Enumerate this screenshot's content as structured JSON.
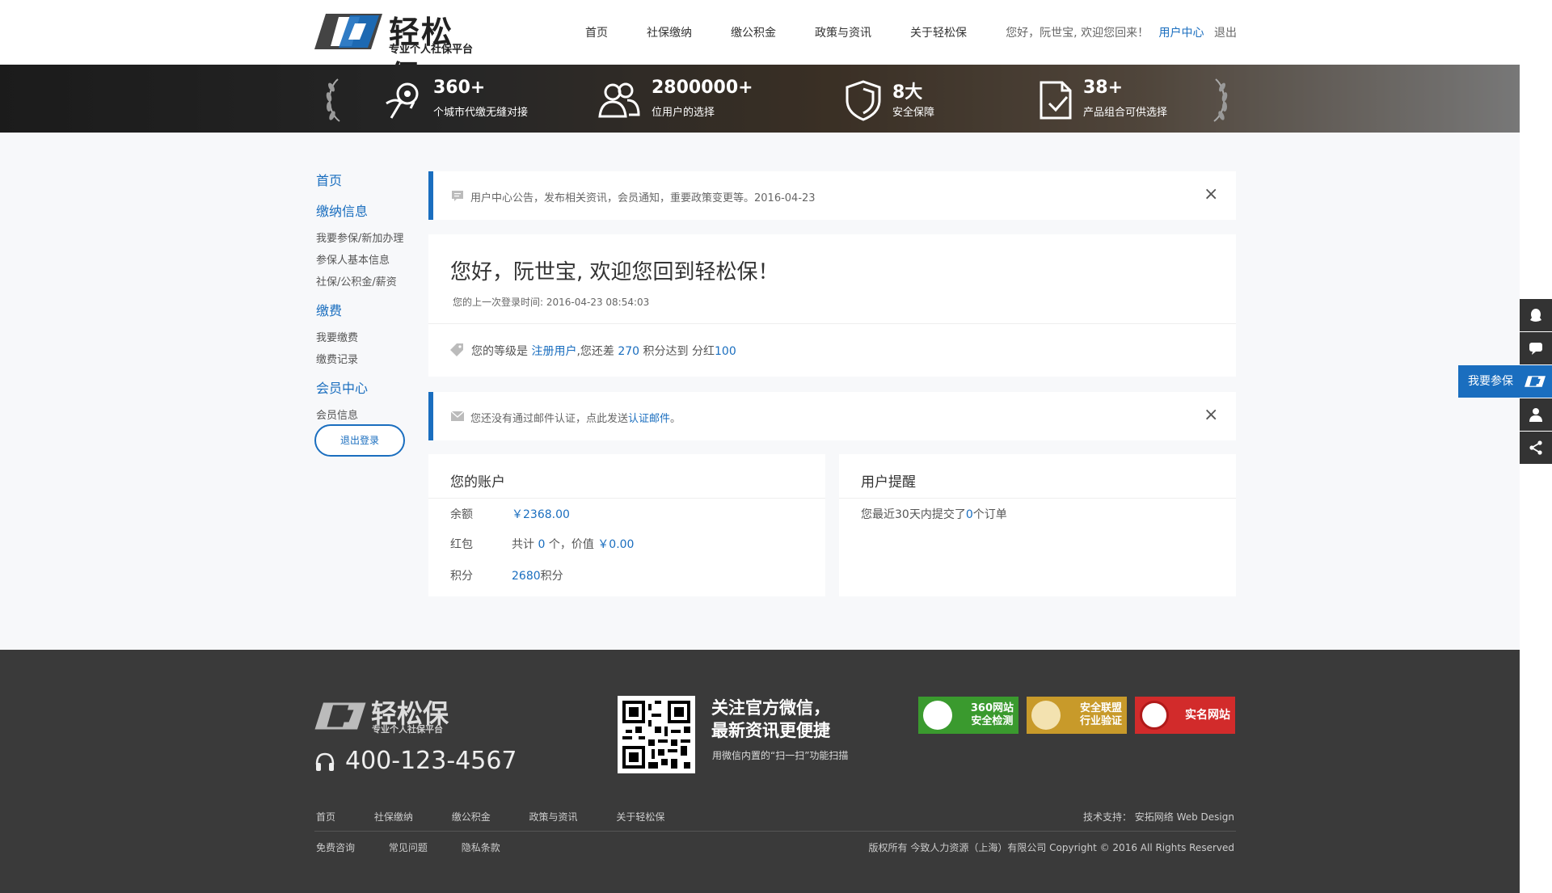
{
  "brand": {
    "name": "轻松保",
    "tagline": "专业个人社保平台"
  },
  "nav": {
    "items": [
      "首页",
      "社保缴纳",
      "缴公积金",
      "政策与资讯",
      "关于轻松保"
    ]
  },
  "userbar": {
    "greeting": "您好，阮世宝, 欢迎您回来！",
    "user_center": "用户中心",
    "logout": "退出"
  },
  "stats": [
    {
      "num": "360+",
      "label": "个城市代缴无缝对接",
      "icon": "location-pin-icon"
    },
    {
      "num": "2800000+",
      "label": "位用户的选择",
      "icon": "users-icon"
    },
    {
      "num": "8大",
      "label": "安全保障",
      "icon": "shield-icon"
    },
    {
      "num": "38+",
      "label": "产品组合可供选择",
      "icon": "document-check-icon"
    }
  ],
  "sidebar": {
    "home": "首页",
    "sections": [
      {
        "title": "缴纳信息",
        "items": [
          "我要参保/新加办理",
          "参保人基本信息",
          "社保/公积金/薪资"
        ]
      },
      {
        "title": "缴费",
        "items": [
          "我要缴费",
          "缴费记录"
        ]
      },
      {
        "title": "会员中心",
        "items": [
          "会员信息"
        ]
      }
    ],
    "logout_button": "退出登录"
  },
  "notice1": {
    "text": "用户中心公告，发布相关资讯，会员通知，重要政策变更等。2016-04-23"
  },
  "welcome": {
    "title": "您好，阮世宝, 欢迎您回到轻松保！",
    "last_login": "您的上一次登录时间: 2016-04-23 08:54:03",
    "level_prefix": "您的等级是",
    "level": "注册用户",
    "level_mid": ",您还差",
    "points_needed": "270",
    "level_suffix": "积分达到 分红",
    "next_level": "100"
  },
  "notice2": {
    "text_prefix": "您还没有通过邮件认证，点此发送",
    "link": "认证邮件",
    "text_suffix": "。"
  },
  "account": {
    "title": "您的账户",
    "balance_label": "余额",
    "balance": "￥2368.00",
    "redpacket_label": "红包",
    "redpacket_prefix": "共计",
    "redpacket_count": "0",
    "redpacket_mid": "个，价值",
    "redpacket_value": "￥0.00",
    "points_label": "积分",
    "points": "2680",
    "points_unit": "积分"
  },
  "reminder": {
    "title": "用户提醒",
    "text_prefix": "您最近30天内提交了",
    "count": "0",
    "text_suffix": "个订单"
  },
  "float_cta": "我要参保",
  "footer": {
    "phone": "400-123-4567",
    "wechat_title_1": "关注官方微信，",
    "wechat_title_2": "最新资讯更便捷",
    "wechat_sub": "用微信内置的“扫一扫”功能扫描",
    "badges": [
      {
        "line1": "360网站",
        "line2": "安全检测",
        "color": "#3a9a2e"
      },
      {
        "line1": "安全联盟",
        "line2": "行业验证",
        "color": "#c89a2a"
      },
      {
        "line1": "实名网站",
        "line2": "",
        "color": "#d22b2b"
      }
    ],
    "links1": [
      "首页",
      "社保缴纳",
      "缴公积金",
      "政策与资讯",
      "关于轻松保"
    ],
    "links2": [
      "免费咨询",
      "常见问题",
      "隐私条款"
    ],
    "tech": "技术支持： 安拓网络 Web Design",
    "copyright": "版权所有 今致人力资源（上海）有限公司   Copyright © 2016 All Rights Reserved"
  }
}
